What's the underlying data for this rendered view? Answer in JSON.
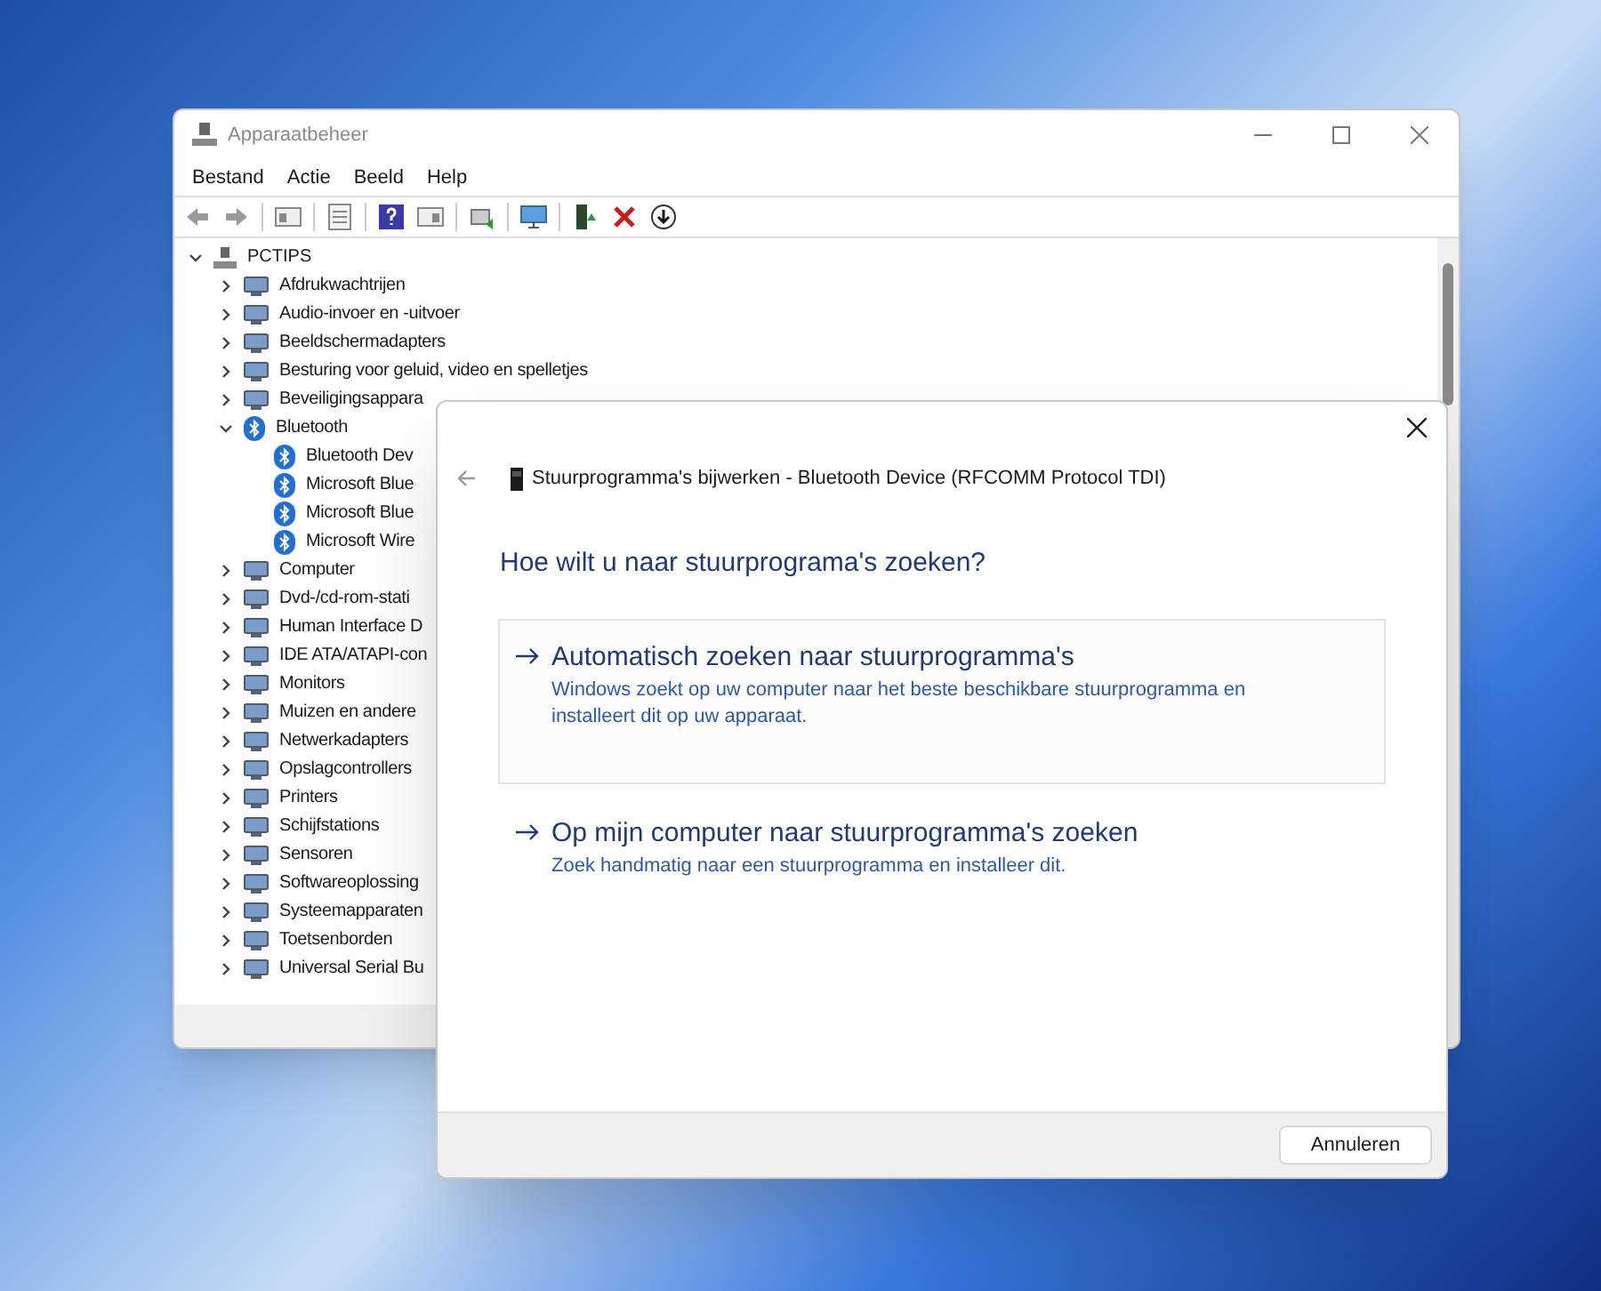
{
  "window": {
    "title": "Apparaatbeheer",
    "menu": [
      "Bestand",
      "Actie",
      "Beeld",
      "Help"
    ]
  },
  "tree": {
    "label": "PCTIPS",
    "expanded": true,
    "children": [
      {
        "label": "Afdrukwachtrijen",
        "kind": "device",
        "expanded": false
      },
      {
        "label": "Audio-invoer en -uitvoer",
        "kind": "device",
        "expanded": false
      },
      {
        "label": "Beeldschermadapters",
        "kind": "device",
        "expanded": false
      },
      {
        "label": "Besturing voor geluid, video en spelletjes",
        "kind": "device",
        "expanded": false
      },
      {
        "label": "Beveiligingsappara",
        "kind": "device",
        "expanded": false
      },
      {
        "label": "Bluetooth",
        "kind": "bluetooth",
        "expanded": true,
        "children": [
          {
            "label": "Bluetooth Dev",
            "kind": "bluetooth"
          },
          {
            "label": "Microsoft Blue",
            "kind": "bluetooth"
          },
          {
            "label": "Microsoft Blue",
            "kind": "bluetooth"
          },
          {
            "label": "Microsoft Wire",
            "kind": "bluetooth"
          }
        ]
      },
      {
        "label": "Computer",
        "kind": "device",
        "expanded": false
      },
      {
        "label": "Dvd-/cd-rom-stati",
        "kind": "device",
        "expanded": false
      },
      {
        "label": "Human Interface D",
        "kind": "device",
        "expanded": false
      },
      {
        "label": "IDE ATA/ATAPI-con",
        "kind": "device",
        "expanded": false
      },
      {
        "label": "Monitors",
        "kind": "device",
        "expanded": false
      },
      {
        "label": "Muizen en andere",
        "kind": "device",
        "expanded": false
      },
      {
        "label": "Netwerkadapters",
        "kind": "device",
        "expanded": false
      },
      {
        "label": "Opslagcontrollers",
        "kind": "device",
        "expanded": false
      },
      {
        "label": "Printers",
        "kind": "device",
        "expanded": false
      },
      {
        "label": "Schijfstations",
        "kind": "device",
        "expanded": false
      },
      {
        "label": "Sensoren",
        "kind": "device",
        "expanded": false
      },
      {
        "label": "Softwareoplossing",
        "kind": "device",
        "expanded": false
      },
      {
        "label": "Systeemapparaten",
        "kind": "device",
        "expanded": false
      },
      {
        "label": "Toetsenborden",
        "kind": "device",
        "expanded": false
      },
      {
        "label": "Universal Serial Bu",
        "kind": "device",
        "expanded": false
      }
    ]
  },
  "dialog": {
    "title": "Stuurprogramma's bijwerken - Bluetooth Device (RFCOMM Protocol TDI)",
    "heading": "Hoe wilt u naar stuurprograma's zoeken?",
    "options": [
      {
        "title": "Automatisch zoeken naar stuurprogramma's",
        "description": "Windows zoekt op uw computer naar het beste beschikbare stuurprogramma en installeert dit op uw apparaat.",
        "selected": true
      },
      {
        "title": "Op mijn computer naar stuurprogramma's zoeken",
        "description": "Zoek handmatig naar een stuurprogramma en installeer dit.",
        "selected": false
      }
    ],
    "cancel_button": "Annuleren"
  }
}
